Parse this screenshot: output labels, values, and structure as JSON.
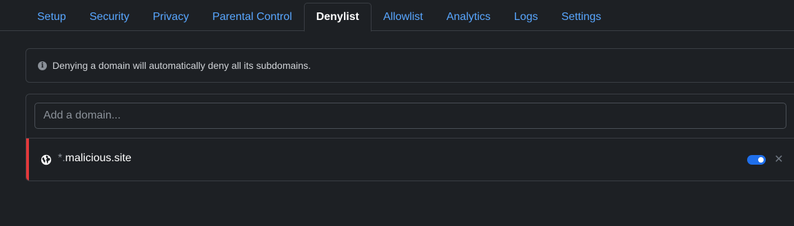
{
  "tabs": [
    {
      "label": "Setup",
      "active": false
    },
    {
      "label": "Security",
      "active": false
    },
    {
      "label": "Privacy",
      "active": false
    },
    {
      "label": "Parental Control",
      "active": false
    },
    {
      "label": "Denylist",
      "active": true
    },
    {
      "label": "Allowlist",
      "active": false
    },
    {
      "label": "Analytics",
      "active": false
    },
    {
      "label": "Logs",
      "active": false
    },
    {
      "label": "Settings",
      "active": false
    }
  ],
  "info": {
    "icon": "info-icon",
    "text": "Denying a domain will automatically deny all its subdomains."
  },
  "add_domain": {
    "placeholder": "Add a domain...",
    "value": ""
  },
  "denylist": [
    {
      "icon": "globe-icon",
      "wildcard_prefix": "*.",
      "domain": "malicious.site",
      "enabled": true,
      "accent_color": "#e5383b"
    }
  ],
  "colors": {
    "link": "#58a6ff",
    "toggle_on": "#1f6feb",
    "background": "#1d2024"
  }
}
